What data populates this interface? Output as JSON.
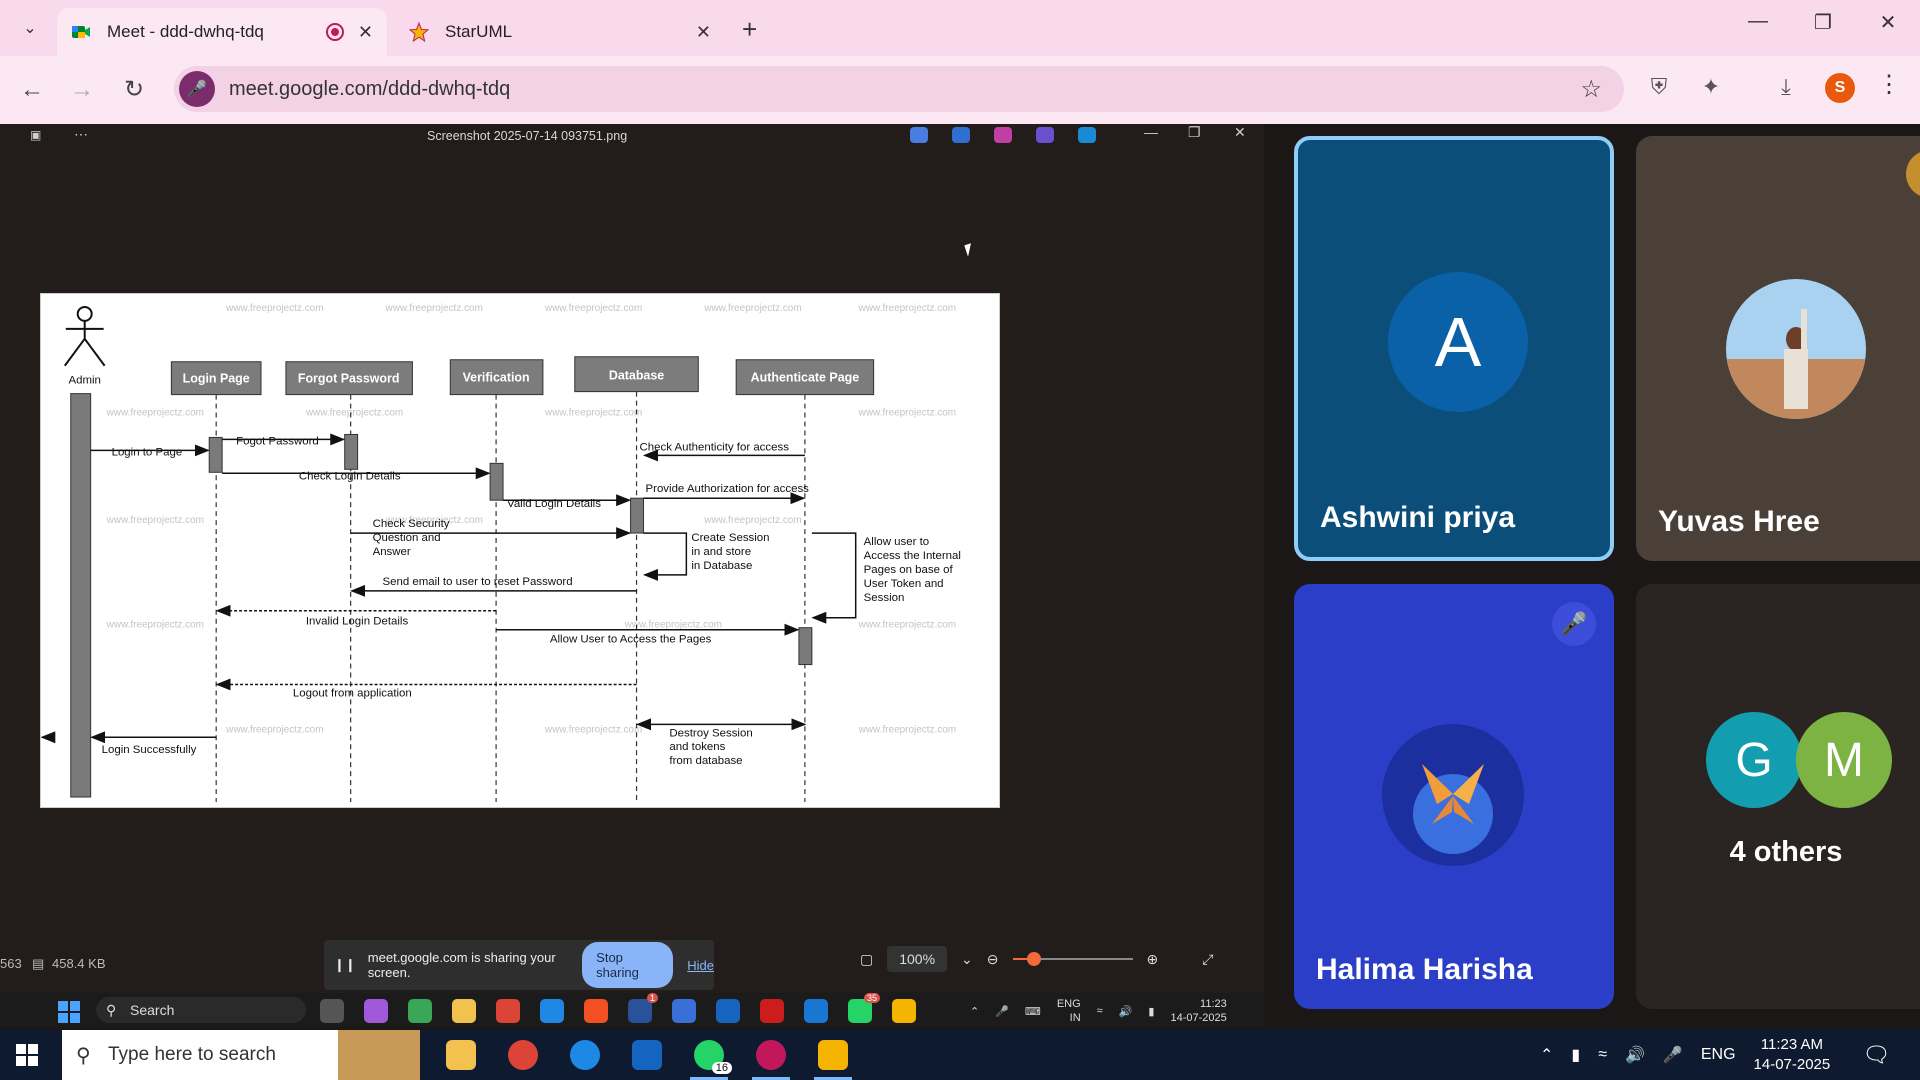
{
  "browser": {
    "tabs": [
      {
        "title": "Meet - ddd-dwhq-tdq",
        "active": true
      },
      {
        "title": "StarUML",
        "active": false
      }
    ],
    "url": "meet.google.com/ddd-dwhq-tdq",
    "profile_initial": "S"
  },
  "viewer": {
    "file_title": "Screenshot 2025-07-14 093751.png",
    "status_left": "563",
    "file_size": "458.4 KB",
    "zoom": "100%"
  },
  "share_bar": {
    "message": "meet.google.com is sharing your screen.",
    "stop_label": "Stop sharing",
    "hide_label": "Hide"
  },
  "diagram": {
    "watermark": "www.freeprojectz.com",
    "actor": "Admin",
    "lifelines": [
      "Login Page",
      "Forgot Password",
      "Verification",
      "Database",
      "Authenticate Page"
    ],
    "messages": [
      "Login to Page",
      "Fogot Password",
      "Check Login Details",
      "Check Authenticity for access",
      "Provide Authorization for access",
      "Valid Login Details",
      "Check Security",
      "Question and",
      "Answer",
      "Create Session",
      "in and store",
      "in Database",
      "Allow user to",
      "Access the Internal",
      "Pages on base of",
      "User Token and",
      "Session",
      "Send email to user to reset Password",
      "Invalid Login Details",
      "Allow User to Access the Pages",
      "Logout from application",
      "Destroy Session",
      "and tokens",
      "from database",
      "Login Successfully"
    ]
  },
  "inner_taskbar": {
    "search_label": "Search",
    "lang_top": "ENG",
    "lang_bottom": "IN",
    "time": "11:23",
    "date": "14-07-2025",
    "teams_badge": "1",
    "whatsapp_badge": "35"
  },
  "participants": [
    {
      "name": "Ashwini priya",
      "initial": "A",
      "muted": false
    },
    {
      "name": "Yuvas Hree",
      "muted": true
    },
    {
      "name": "Halima Harisha",
      "muted": true
    },
    {
      "name": "4 others",
      "initials": [
        "G",
        "M"
      ]
    }
  ],
  "os_taskbar": {
    "search_placeholder": "Type here to search",
    "whatsapp_badge": "16",
    "lang": "ENG",
    "time": "11:23 AM",
    "date": "14-07-2025"
  },
  "colors": {
    "tabbar": "#f9d9ec",
    "speaking_border": "#8ecdf5",
    "ashwini_tile": "#0b4e7a",
    "halima_tile": "#2a3ec8",
    "others_g": "#129eaf",
    "others_m": "#7cb342"
  }
}
